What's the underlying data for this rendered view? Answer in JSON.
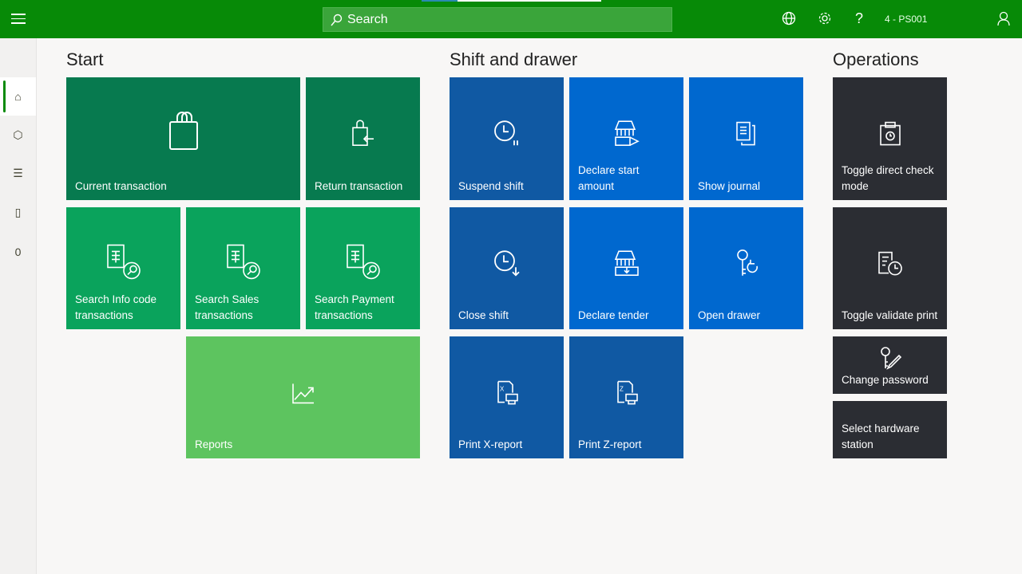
{
  "header": {
    "search_placeholder": "Search",
    "store": "4 - PS001",
    "icons": [
      "menu-icon",
      "search-icon",
      "globe-icon",
      "gear-icon",
      "help-icon",
      "user-icon"
    ],
    "help": "?"
  },
  "sidebar": {
    "items": [
      {
        "icon": "home-icon"
      },
      {
        "icon": "products-icon"
      },
      {
        "icon": "list-icon"
      },
      {
        "icon": "bag-icon"
      },
      {
        "label": "0"
      }
    ]
  },
  "sections": {
    "start": {
      "title": "Start",
      "tiles": [
        "Current transaction",
        "Return transaction",
        "Search Info code transactions",
        "Search Sales transactions",
        "Search Payment transactions",
        "Reports"
      ]
    },
    "shift": {
      "title": "Shift and drawer",
      "tiles": [
        "Suspend shift",
        "Declare start amount",
        "Show journal",
        "Close shift",
        "Declare tender",
        "Open drawer",
        "Print X-report",
        "Print Z-report"
      ]
    },
    "operations": {
      "title": "Operations",
      "tiles": [
        "Toggle direct check mode",
        "Toggle validate print",
        "Change password",
        "Select hardware station"
      ]
    }
  },
  "colors": {
    "header": "#078a07",
    "start_dark": "#077a4f",
    "start_mid": "#0aa35c",
    "start_light": "#5dc45f",
    "shift_dark": "#1059a3",
    "shift": "#0068cf",
    "operations": "#2b2d33"
  }
}
